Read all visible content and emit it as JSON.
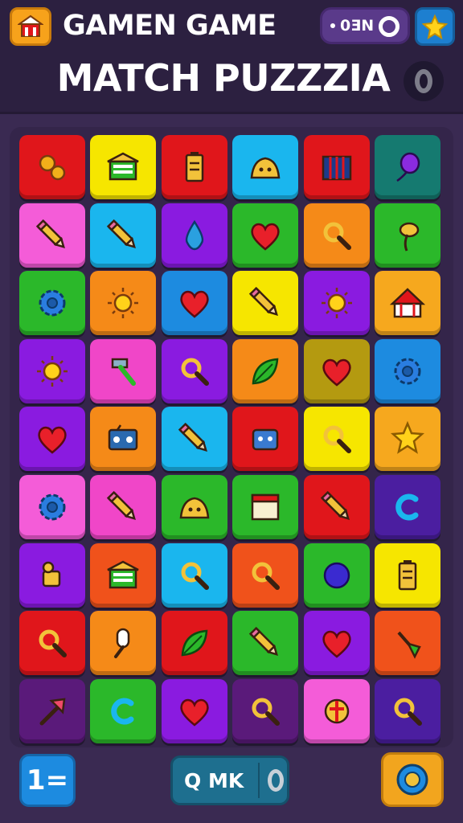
{
  "header": {
    "app_title": "GAMEN GAME",
    "game_title": "MATCH PUZZZIA",
    "toggle_label": "0ƎN"
  },
  "footer": {
    "left_label": "1=",
    "center_label": "Q MK"
  },
  "board": {
    "rows": 9,
    "cols": 6,
    "tiles": [
      [
        {
          "color": "#e0161b",
          "icon": "gears-icon"
        },
        {
          "color": "#f6e600",
          "icon": "shop-icon"
        },
        {
          "color": "#e0161b",
          "icon": "battery-icon"
        },
        {
          "color": "#1ab6ee",
          "icon": "slime-icon"
        },
        {
          "color": "#e0161b",
          "icon": "cage-icon"
        },
        {
          "color": "#157a70",
          "icon": "balloon-icon"
        }
      ],
      [
        {
          "color": "#f45cd8",
          "icon": "pencil-icon"
        },
        {
          "color": "#1ab6ee",
          "icon": "pencil-icon"
        },
        {
          "color": "#8a1be0",
          "icon": "drop-icon"
        },
        {
          "color": "#2bb82a",
          "icon": "heart-icon"
        },
        {
          "color": "#f58a18",
          "icon": "magnifier-icon"
        },
        {
          "color": "#2bb82a",
          "icon": "plant-icon"
        }
      ],
      [
        {
          "color": "#2bb82a",
          "icon": "gear-icon"
        },
        {
          "color": "#f58a18",
          "icon": "sun-icon"
        },
        {
          "color": "#1d8be0",
          "icon": "heart-icon"
        },
        {
          "color": "#f6e600",
          "icon": "pencil-icon"
        },
        {
          "color": "#8a1be0",
          "icon": "sun-icon"
        },
        {
          "color": "#f6a81e",
          "icon": "circus-tent-icon"
        }
      ],
      [
        {
          "color": "#8a1be0",
          "icon": "sun-icon"
        },
        {
          "color": "#f046c8",
          "icon": "hammer-icon"
        },
        {
          "color": "#8a1be0",
          "icon": "magnifier-icon"
        },
        {
          "color": "#f58a18",
          "icon": "leaf-icon"
        },
        {
          "color": "#b49a10",
          "icon": "heart-icon"
        },
        {
          "color": "#1d8be0",
          "icon": "gear-icon"
        }
      ],
      [
        {
          "color": "#8a1be0",
          "icon": "heart-icon"
        },
        {
          "color": "#f58a18",
          "icon": "radio-icon"
        },
        {
          "color": "#1ab6ee",
          "icon": "pencil-icon"
        },
        {
          "color": "#e0161b",
          "icon": "robot-icon"
        },
        {
          "color": "#f6e600",
          "icon": "magnifier-icon"
        },
        {
          "color": "#f6a81e",
          "icon": "star-icon"
        }
      ],
      [
        {
          "color": "#f45cd8",
          "icon": "gear-icon"
        },
        {
          "color": "#f046c8",
          "icon": "pencil-icon"
        },
        {
          "color": "#2bb82a",
          "icon": "slime-icon"
        },
        {
          "color": "#2bb82a",
          "icon": "frame-icon"
        },
        {
          "color": "#e0161b",
          "icon": "pencil-icon"
        },
        {
          "color": "#4b1ea0",
          "icon": "c-icon"
        }
      ],
      [
        {
          "color": "#8a1be0",
          "icon": "puzzle-icon"
        },
        {
          "color": "#f0521b",
          "icon": "shop-icon"
        },
        {
          "color": "#1ab6ee",
          "icon": "magnifier-icon"
        },
        {
          "color": "#f0521b",
          "icon": "magnifier-icon"
        },
        {
          "color": "#2bb82a",
          "icon": "blob-icon"
        },
        {
          "color": "#f6e600",
          "icon": "battery-icon"
        }
      ],
      [
        {
          "color": "#e0161b",
          "icon": "magnifier-icon"
        },
        {
          "color": "#f58a18",
          "icon": "microphone-icon"
        },
        {
          "color": "#e0161b",
          "icon": "leaf-icon"
        },
        {
          "color": "#2bb82a",
          "icon": "pencil-icon"
        },
        {
          "color": "#8a1be0",
          "icon": "heart-icon"
        },
        {
          "color": "#f0521b",
          "icon": "broom-icon"
        }
      ],
      [
        {
          "color": "#5a1a7a",
          "icon": "arrow-icon"
        },
        {
          "color": "#2bb82a",
          "icon": "c-icon"
        },
        {
          "color": "#8a1be0",
          "icon": "heart-icon"
        },
        {
          "color": "#5a1a7a",
          "icon": "magnifier-icon"
        },
        {
          "color": "#f45cd8",
          "icon": "compass-icon"
        },
        {
          "color": "#4b1ea0",
          "icon": "magnifier-icon"
        }
      ]
    ]
  }
}
